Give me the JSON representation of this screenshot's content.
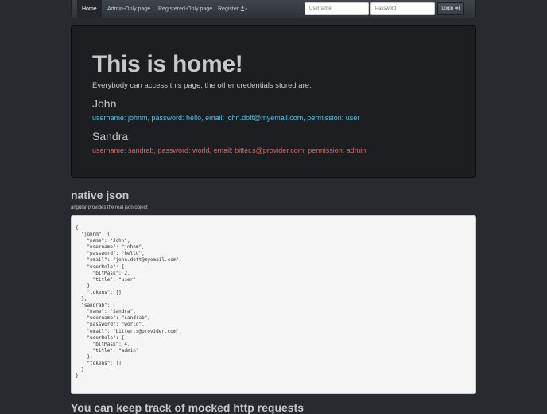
{
  "navbar": {
    "home": "Home",
    "admin_only": "Admin-Only page",
    "registered_only": "Registered-Only page",
    "register": "Register",
    "username_placeholder": "Username",
    "password_placeholder": "Password",
    "login": "Login",
    "icons": {
      "register": "user-plus-icon",
      "login": "sign-in-icon"
    }
  },
  "jumbotron": {
    "title": "This is home!",
    "lead": "Everybody can access this page, the other credentials stored are:",
    "users": [
      {
        "name": "John",
        "credentials": "username: johnm, password: hello, email: john.dott@myemail.com, permission: user"
      },
      {
        "name": "Sandra",
        "credentials": "username: sandrab, password: world, email: bitter.s@provider.com, permission: admin"
      }
    ]
  },
  "native_json": {
    "title": "native json",
    "subtitle": "angular provides the real json object",
    "code": "{\n  \"johnm\": {\n    \"name\": \"John\",\n    \"username\": \"johnm\",\n    \"password\": \"hello\",\n    \"email\": \"john.dott@myemail.com\",\n    \"userRole\": {\n      \"bitMask\": 2,\n      \"title\": \"user\"\n    },\n    \"tokens\": []\n  },\n  \"sandrab\": {\n    \"name\": \"Sandra\",\n    \"username\": \"sandrab\",\n    \"password\": \"world\",\n    \"email\": \"bitter.s@provider.com\",\n    \"userRole\": {\n      \"bitMask\": 4,\n      \"title\": \"admin\"\n    },\n    \"tokens\": []\n  }\n}"
  },
  "mock": {
    "title": "You can keep track of mocked http requests"
  },
  "colors": {
    "info": "#5bc0de",
    "danger": "#ee5f5b",
    "background": "#272b30"
  }
}
